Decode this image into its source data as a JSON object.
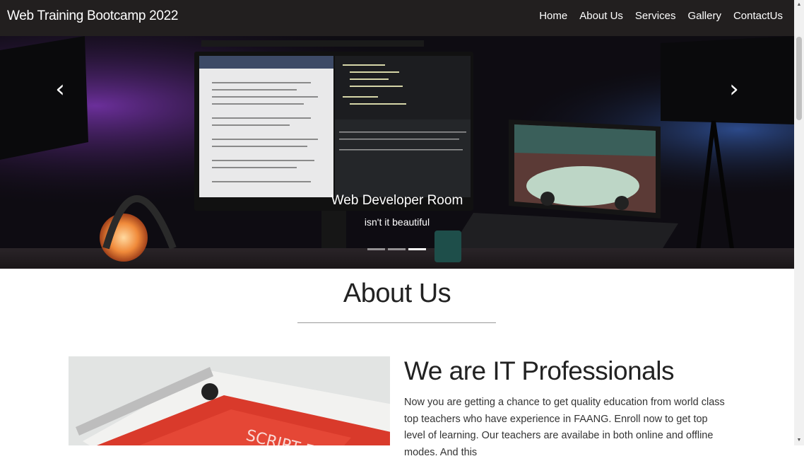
{
  "navbar": {
    "brand": "Web Training Bootcamp 2022",
    "links": [
      "Home",
      "About Us",
      "Services",
      "Gallery",
      "ContactUs"
    ]
  },
  "carousel": {
    "title": "Web Developer Room",
    "subtitle": "isn't it beautiful",
    "prev_icon": "chevron-left-icon",
    "next_icon": "chevron-right-icon",
    "active_slide": 3,
    "slide_count": 3
  },
  "about": {
    "heading": "About Us",
    "pro_title": "We are IT Professionals",
    "pro_text": "Now you are getting a chance to get quality education from world class top teachers who have experience in FAANG. Enroll now to get top level of learning. Our teachers are availabe in both online and offline modes. And this",
    "photo_alt": "book-photo"
  },
  "colors": {
    "navbar_bg": "#221f1f",
    "text_dark": "#222222"
  }
}
